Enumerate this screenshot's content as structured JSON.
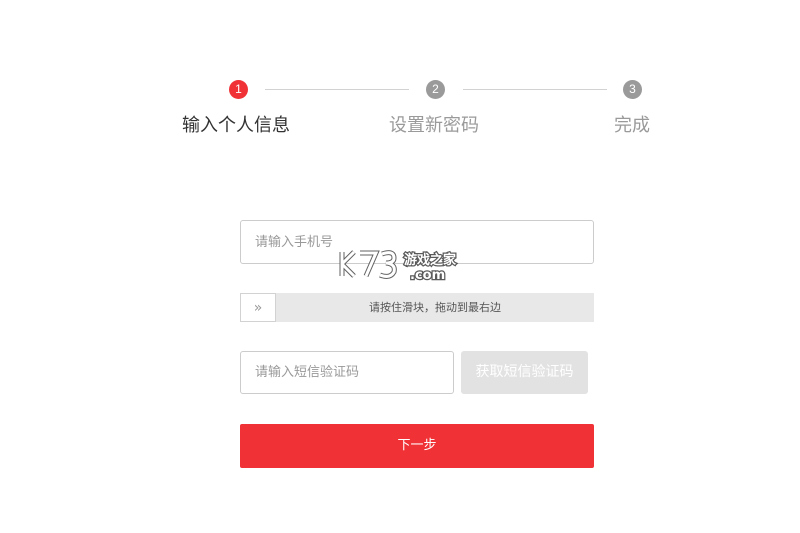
{
  "stepper": {
    "steps": [
      {
        "number": "1",
        "label": "输入个人信息",
        "state": "active"
      },
      {
        "number": "2",
        "label": "设置新密码",
        "state": "inactive"
      },
      {
        "number": "3",
        "label": "完成",
        "state": "inactive"
      }
    ]
  },
  "form": {
    "phone_placeholder": "请输入手机号",
    "slider": {
      "handle_icon": "double-chevron-right-icon",
      "handle_glyph": "»",
      "hint": "请按住滑块，拖动到最右边"
    },
    "sms_placeholder": "请输入短信验证码",
    "sms_button_label": "获取短信验证码",
    "next_button_label": "下一步"
  },
  "watermark": {
    "text": "K73 游戏之家 .com"
  },
  "colors": {
    "accent": "#f03237",
    "inactive_step": "#9a9a9a",
    "disabled_button": "#e2e2e2",
    "slider_track": "#e8e8e8"
  }
}
